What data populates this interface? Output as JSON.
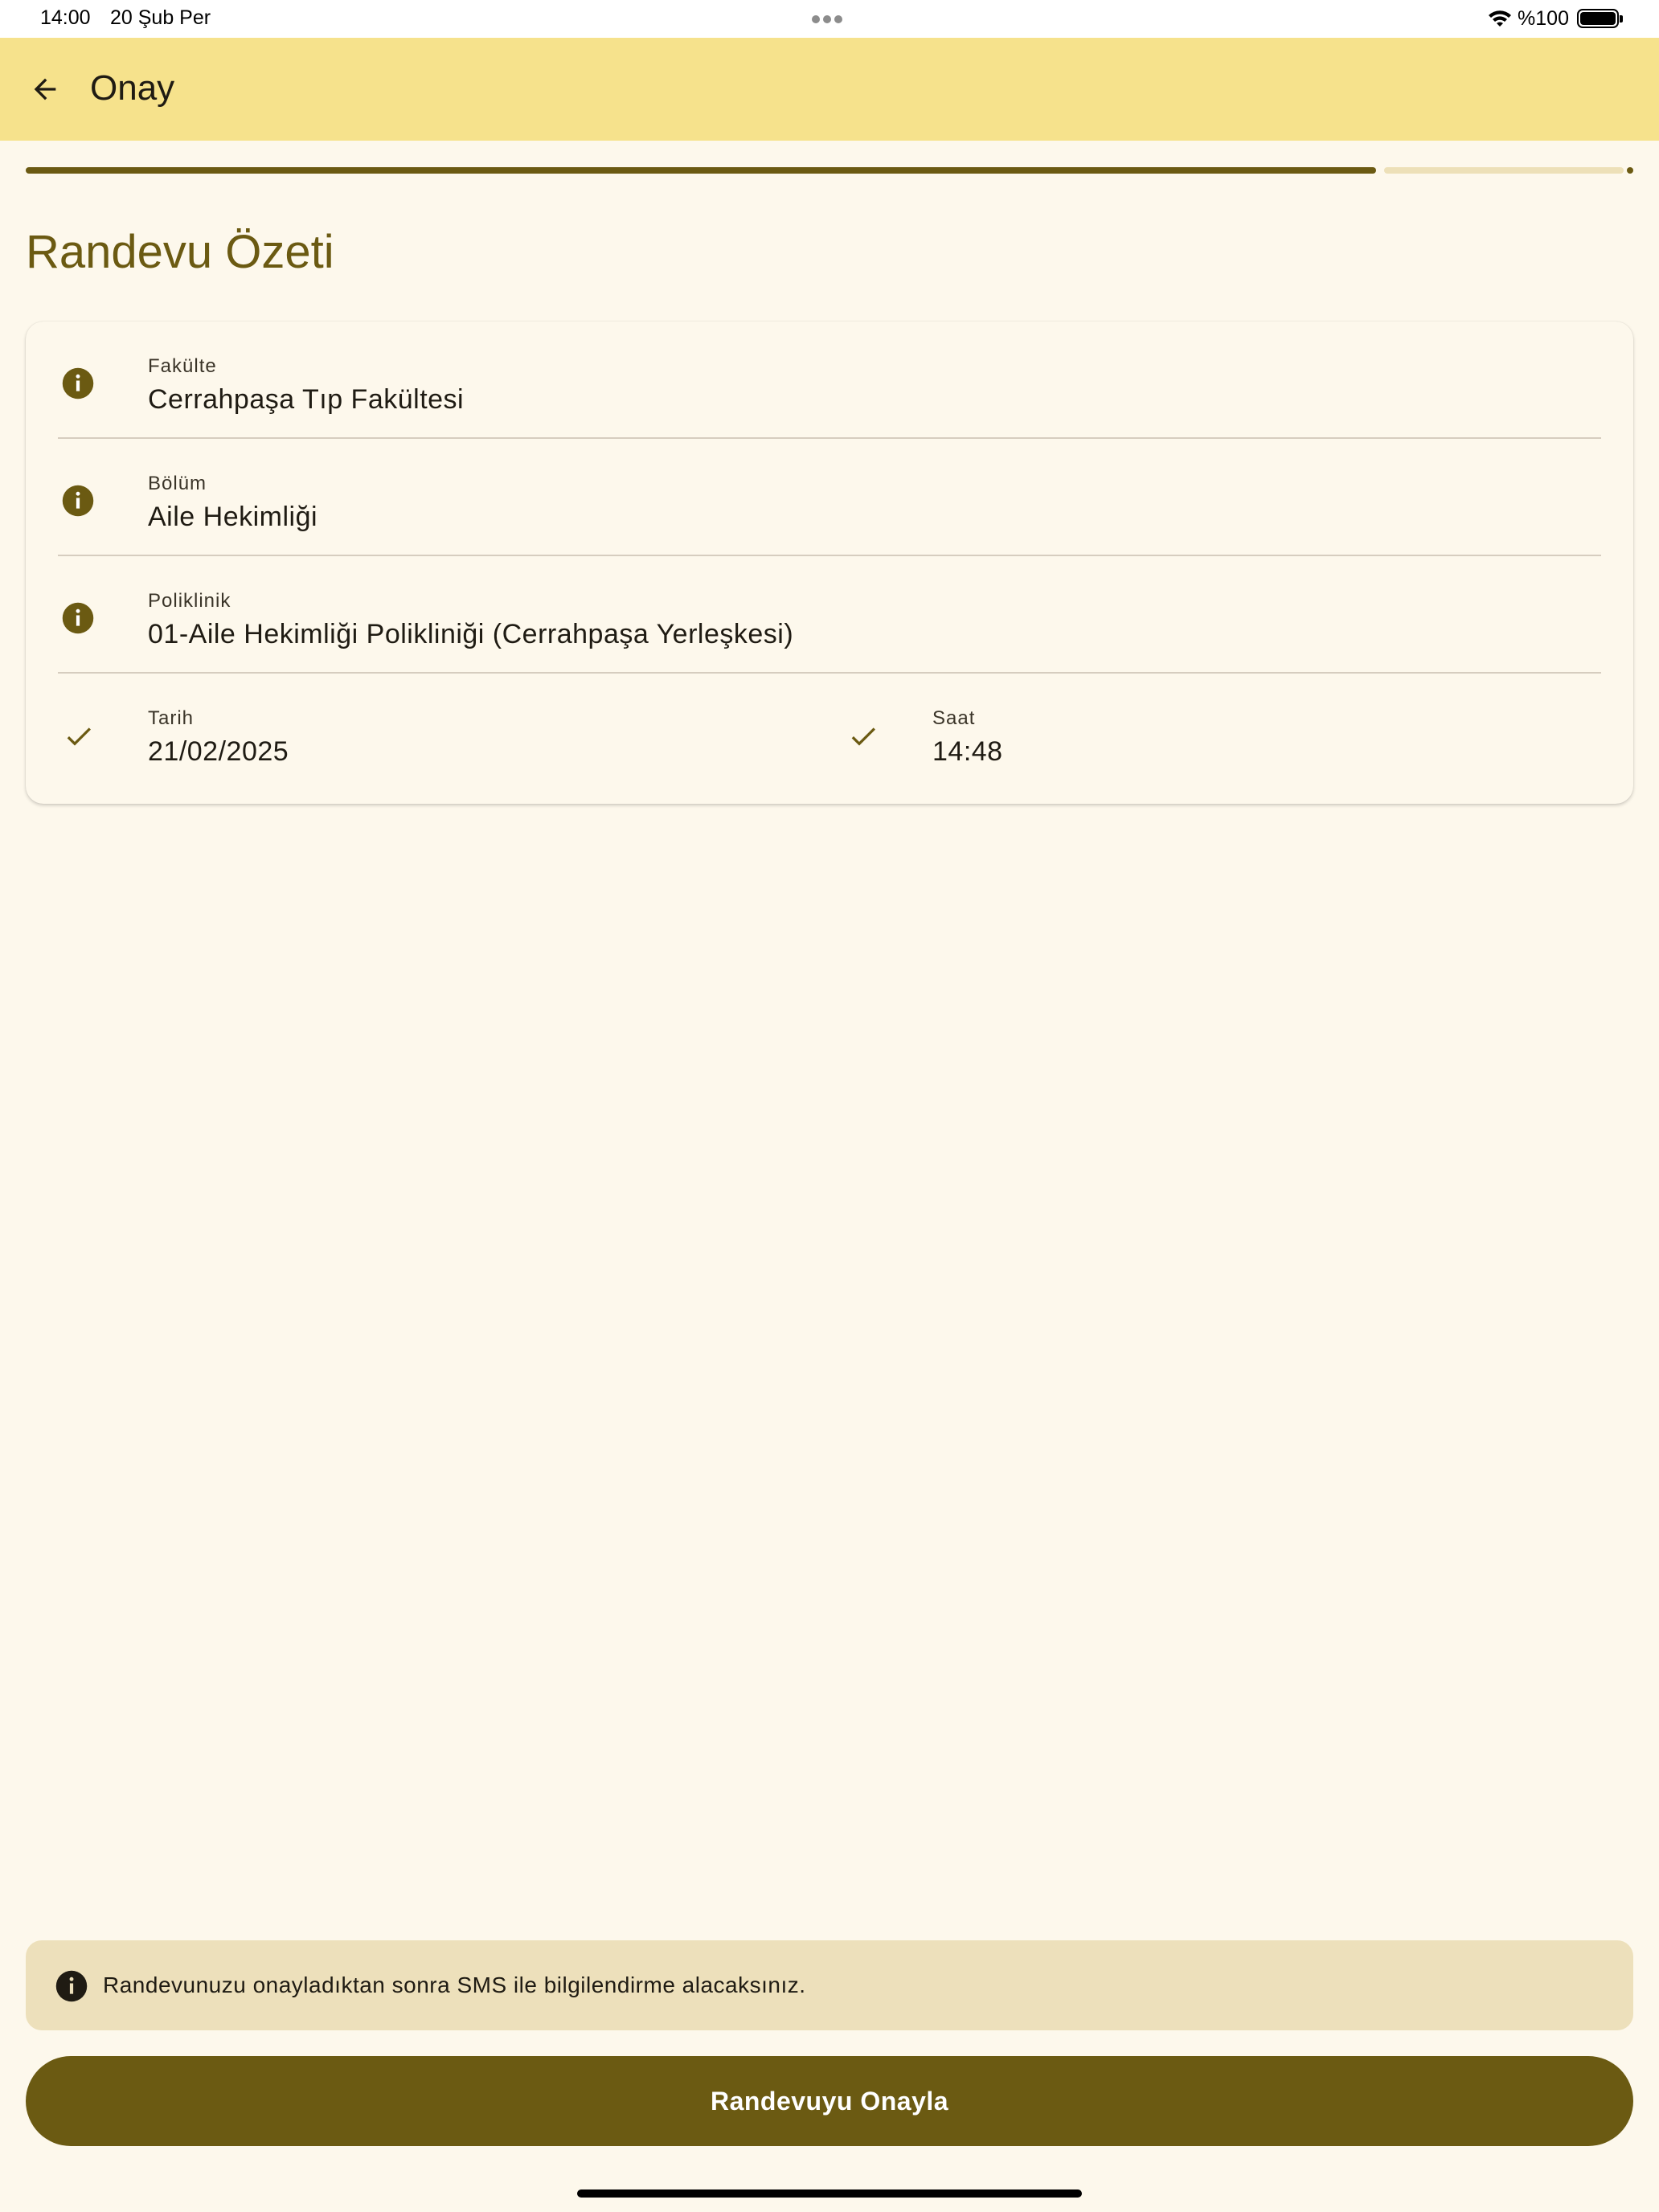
{
  "status_bar": {
    "time": "14:00",
    "date": "20 Şub Per",
    "battery": "%100"
  },
  "app_bar": {
    "title": "Onay",
    "back_icon": "arrow-left-icon"
  },
  "progress": {
    "fraction": 0.84
  },
  "summary": {
    "title": "Randevu Özeti",
    "rows": [
      {
        "label": "Fakülte",
        "value": "Cerrahpaşa Tıp Fakültesi",
        "icon": "info-icon"
      },
      {
        "label": "Bölüm",
        "value": "Aile Hekimliği",
        "icon": "info-icon"
      },
      {
        "label": "Poliklinik",
        "value": "01-Aile Hekimliği Polikliniği (Cerrahpaşa Yerleşkesi)",
        "icon": "info-icon"
      }
    ],
    "date": {
      "label": "Tarih",
      "value": "21/02/2025",
      "icon": "check-icon"
    },
    "time": {
      "label": "Saat",
      "value": "14:48",
      "icon": "check-icon"
    }
  },
  "info_banner": {
    "text": "Randevunuzu onayladıktan sonra SMS ile bilgilendirme alacaksınız.",
    "icon": "info-icon"
  },
  "confirm_button": {
    "label": "Randevuyu Onayla"
  },
  "colors": {
    "primary": "#6b5a12",
    "app_bar": "#f6e28c",
    "background": "#fdf8ec",
    "banner": "#ede0bb"
  }
}
